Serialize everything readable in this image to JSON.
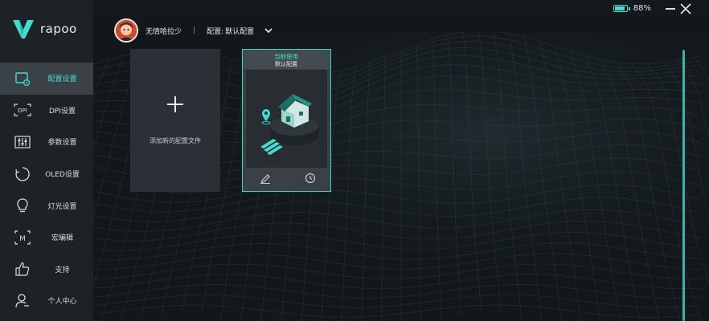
{
  "brand": {
    "name": "rapoo",
    "accent": "#3de0d0"
  },
  "sidebar": {
    "items": [
      {
        "label": "配置设置",
        "icon": "profile-settings-icon",
        "active": true
      },
      {
        "label": "DPI设置",
        "icon": "dpi-icon",
        "active": false
      },
      {
        "label": "参数设置",
        "icon": "sliders-icon",
        "active": false
      },
      {
        "label": "OLED设置",
        "icon": "oled-icon",
        "active": false
      },
      {
        "label": "灯光设置",
        "icon": "lightbulb-icon",
        "active": false
      },
      {
        "label": "宏编辑",
        "icon": "macro-icon",
        "active": false
      },
      {
        "label": "支持",
        "icon": "thumbs-up-icon",
        "active": false
      },
      {
        "label": "个人中心",
        "icon": "user-icon",
        "active": false
      }
    ]
  },
  "header": {
    "username": "无情哈拉少",
    "separator": "|",
    "config_label": "配置:",
    "config_value": "默认配置"
  },
  "window": {
    "battery_percent": "88%",
    "battery_level": 0.88
  },
  "cards": {
    "add_label": "添加新的配置文件",
    "current_status": "当前使用",
    "current_name": "默认配置"
  },
  "dpi_icon_text": "DPI",
  "macro_icon_text": "M"
}
